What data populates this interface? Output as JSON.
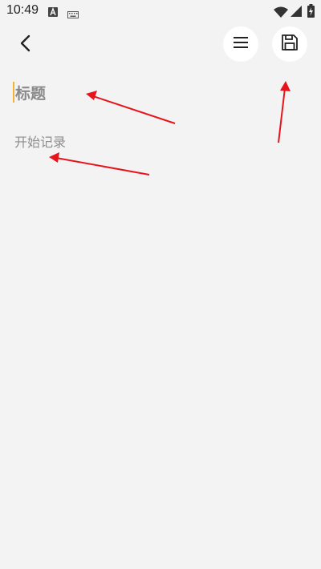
{
  "status_bar": {
    "time": "10:49",
    "icons": [
      "a-badge-icon",
      "keyboard-icon",
      "wifi-icon",
      "signal-icon",
      "battery-charging-icon"
    ]
  },
  "toolbar": {
    "back_icon": "chevron-left-icon",
    "menu_icon": "menu-icon",
    "save_icon": "floppy-disk-icon"
  },
  "editor": {
    "title_placeholder": "标题",
    "body_placeholder": "开始记录"
  },
  "colors": {
    "background": "#f3f3f3",
    "caret": "#f2b233",
    "annotation_arrow": "#e8141b",
    "button_bg": "#ffffff"
  }
}
